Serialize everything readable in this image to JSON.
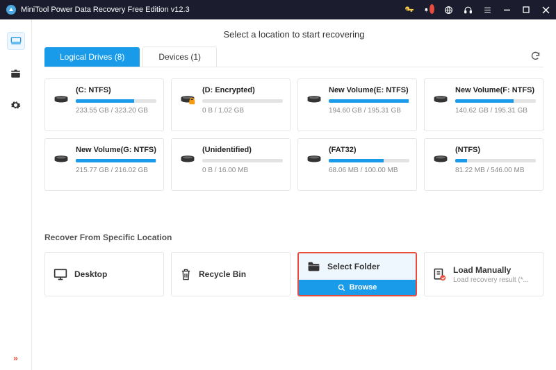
{
  "window": {
    "title": "MiniTool Power Data Recovery Free Edition v12.3"
  },
  "header": "Select a location to start recovering",
  "tabs": {
    "logical": "Logical Drives (8)",
    "devices": "Devices (1)"
  },
  "drives": [
    {
      "name": "(C: NTFS)",
      "used": "233.55 GB / 323.20 GB",
      "pct": 72,
      "locked": false
    },
    {
      "name": "(D: Encrypted)",
      "used": "0 B / 1.02 GB",
      "pct": 0,
      "locked": true
    },
    {
      "name": "New Volume(E: NTFS)",
      "used": "194.60 GB / 195.31 GB",
      "pct": 99,
      "locked": false
    },
    {
      "name": "New Volume(F: NTFS)",
      "used": "140.62 GB / 195.31 GB",
      "pct": 72,
      "locked": false
    },
    {
      "name": "New Volume(G: NTFS)",
      "used": "215.77 GB / 216.02 GB",
      "pct": 99,
      "locked": false
    },
    {
      "name": "(Unidentified)",
      "used": "0 B / 16.00 MB",
      "pct": 0,
      "locked": false
    },
    {
      "name": "(FAT32)",
      "used": "68.06 MB / 100.00 MB",
      "pct": 68,
      "locked": false
    },
    {
      "name": "(NTFS)",
      "used": "81.22 MB / 546.00 MB",
      "pct": 15,
      "locked": false
    }
  ],
  "section_title": "Recover From Specific Location",
  "locations": {
    "desktop": "Desktop",
    "recycle": "Recycle Bin",
    "select_folder": "Select Folder",
    "browse": "Browse",
    "load_manually": "Load Manually",
    "load_sub": "Load recovery result (*..."
  }
}
